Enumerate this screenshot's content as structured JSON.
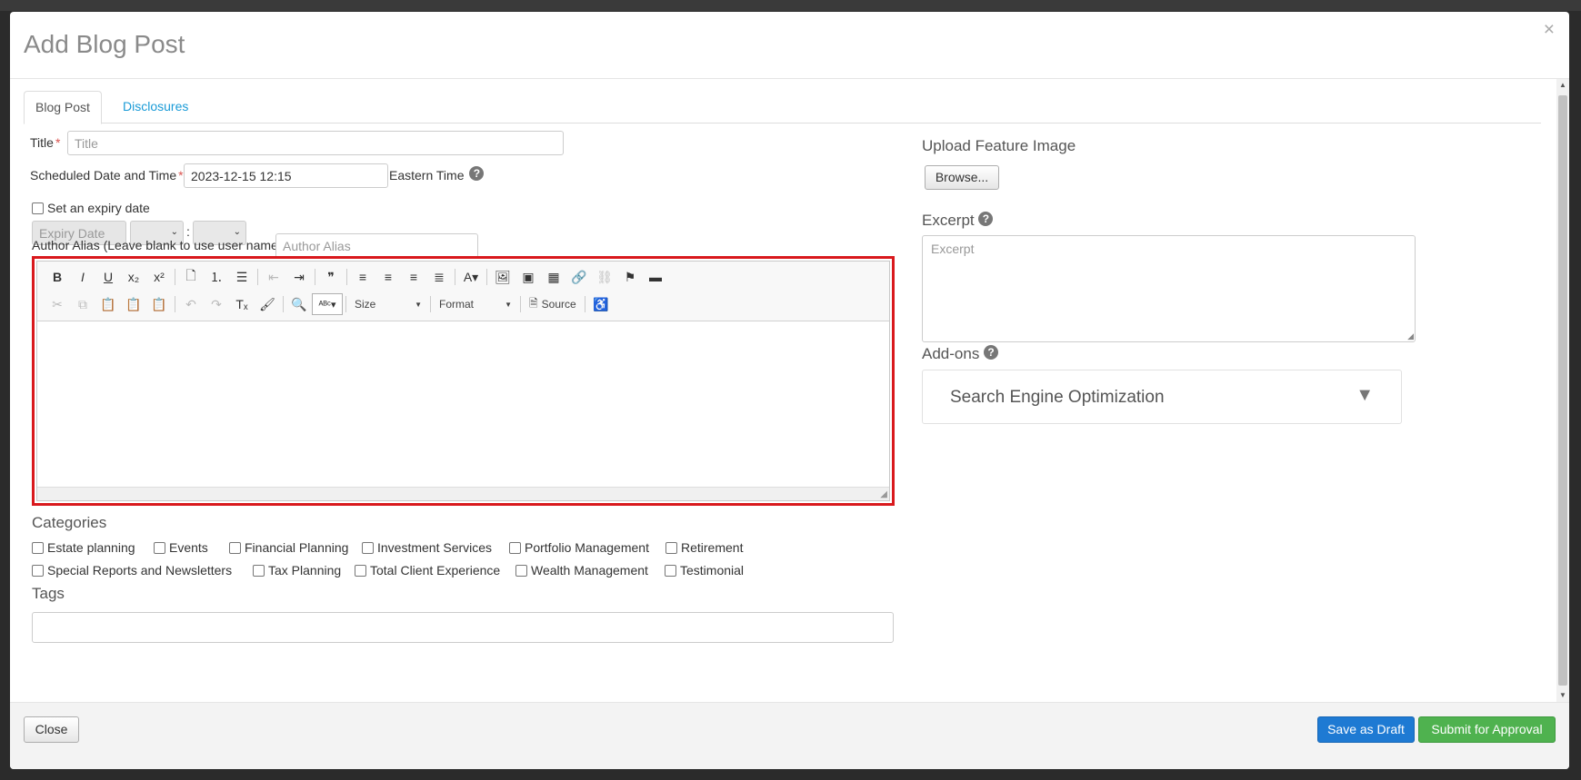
{
  "modal": {
    "title": "Add Blog Post",
    "close_glyph": "×"
  },
  "tabs": [
    {
      "label": "Blog Post",
      "active": true
    },
    {
      "label": "Disclosures",
      "active": false
    }
  ],
  "form": {
    "title_label": "Title",
    "title_placeholder": "Title",
    "required_mark": "*",
    "scheduled_label": "Scheduled Date and Time",
    "scheduled_value": "2023-12-15 12:15",
    "timezone_label": "Eastern Time",
    "help_glyph": "?",
    "expiry_checkbox_label": "Set an expiry date",
    "expiry_placeholder": "Expiry Date",
    "time_separator": ":",
    "author_alias_label": "Author Alias (Leave blank to use user name)",
    "author_alias_placeholder": "Author Alias"
  },
  "editor": {
    "toolbar_row1": [
      {
        "name": "bold-button",
        "glyph": "B"
      },
      {
        "name": "italic-button",
        "glyph": "I"
      },
      {
        "name": "underline-button",
        "glyph": "U"
      },
      {
        "name": "subscript-button",
        "glyph": "x₂"
      },
      {
        "name": "superscript-button",
        "glyph": "x²"
      },
      {
        "name": "sep"
      },
      {
        "name": "document-icon",
        "glyph": "🗋"
      },
      {
        "name": "numbered-list-button",
        "glyph": "⒈"
      },
      {
        "name": "bulleted-list-button",
        "glyph": "☰"
      },
      {
        "name": "sep"
      },
      {
        "name": "outdent-button",
        "glyph": "⇤",
        "disabled": true
      },
      {
        "name": "indent-button",
        "glyph": "⇥"
      },
      {
        "name": "sep"
      },
      {
        "name": "blockquote-button",
        "glyph": "❞"
      },
      {
        "name": "sep"
      },
      {
        "name": "align-left-button",
        "glyph": "≡"
      },
      {
        "name": "align-center-button",
        "glyph": "≡"
      },
      {
        "name": "align-right-button",
        "glyph": "≡"
      },
      {
        "name": "justify-button",
        "glyph": "≣"
      },
      {
        "name": "sep"
      },
      {
        "name": "text-color-button",
        "glyph": "A▾"
      },
      {
        "name": "sep"
      },
      {
        "name": "image-button",
        "glyph": "🖼"
      },
      {
        "name": "flash-button",
        "glyph": "▣"
      },
      {
        "name": "table-button",
        "glyph": "▦"
      },
      {
        "name": "link-button",
        "glyph": "🔗"
      },
      {
        "name": "unlink-button",
        "glyph": "⛓",
        "disabled": true
      },
      {
        "name": "anchor-button",
        "glyph": "⚑"
      },
      {
        "name": "horizontal-rule-button",
        "glyph": "▬"
      }
    ],
    "toolbar_row2": [
      {
        "name": "cut-button",
        "glyph": "✂",
        "disabled": true
      },
      {
        "name": "copy-button",
        "glyph": "⧉",
        "disabled": true
      },
      {
        "name": "paste-button",
        "glyph": "📋"
      },
      {
        "name": "paste-text-button",
        "glyph": "📋"
      },
      {
        "name": "paste-word-button",
        "glyph": "📋"
      },
      {
        "name": "sep"
      },
      {
        "name": "undo-button",
        "glyph": "↶",
        "disabled": true
      },
      {
        "name": "redo-button",
        "glyph": "↷",
        "disabled": true
      },
      {
        "name": "remove-format-button",
        "glyph": "Tₓ"
      },
      {
        "name": "copy-format-button",
        "glyph": "🖌"
      },
      {
        "name": "sep"
      },
      {
        "name": "find-button",
        "glyph": "🔍"
      },
      {
        "name": "spellcheck-button",
        "glyph": "ᴬᴮᶜ▾",
        "boxed": true
      }
    ],
    "size_label": "Size",
    "format_label": "Format",
    "source_label": "Source",
    "accessibility_glyph": "♿"
  },
  "categories": {
    "title": "Categories",
    "items": [
      "Estate planning",
      "Events",
      "Financial Planning",
      "Investment Services",
      "Portfolio Management",
      "Retirement",
      "Special Reports and Newsletters",
      "Tax Planning",
      "Total Client Experience",
      "Wealth Management",
      "Testimonial"
    ]
  },
  "tags": {
    "title": "Tags"
  },
  "right": {
    "upload_title": "Upload Feature Image",
    "browse_label": "Browse...",
    "excerpt_title": "Excerpt",
    "excerpt_placeholder": "Excerpt",
    "addons_title": "Add-ons",
    "seo_label": "Search Engine Optimization",
    "seo_arrow": "▼"
  },
  "footer": {
    "close_label": "Close",
    "draft_label": "Save as Draft",
    "submit_label": "Submit for Approval"
  },
  "colors": {
    "highlight": "#d9191d",
    "primary": "#1e7ad3",
    "success": "#4fb24f",
    "link": "#1a9bd7"
  }
}
